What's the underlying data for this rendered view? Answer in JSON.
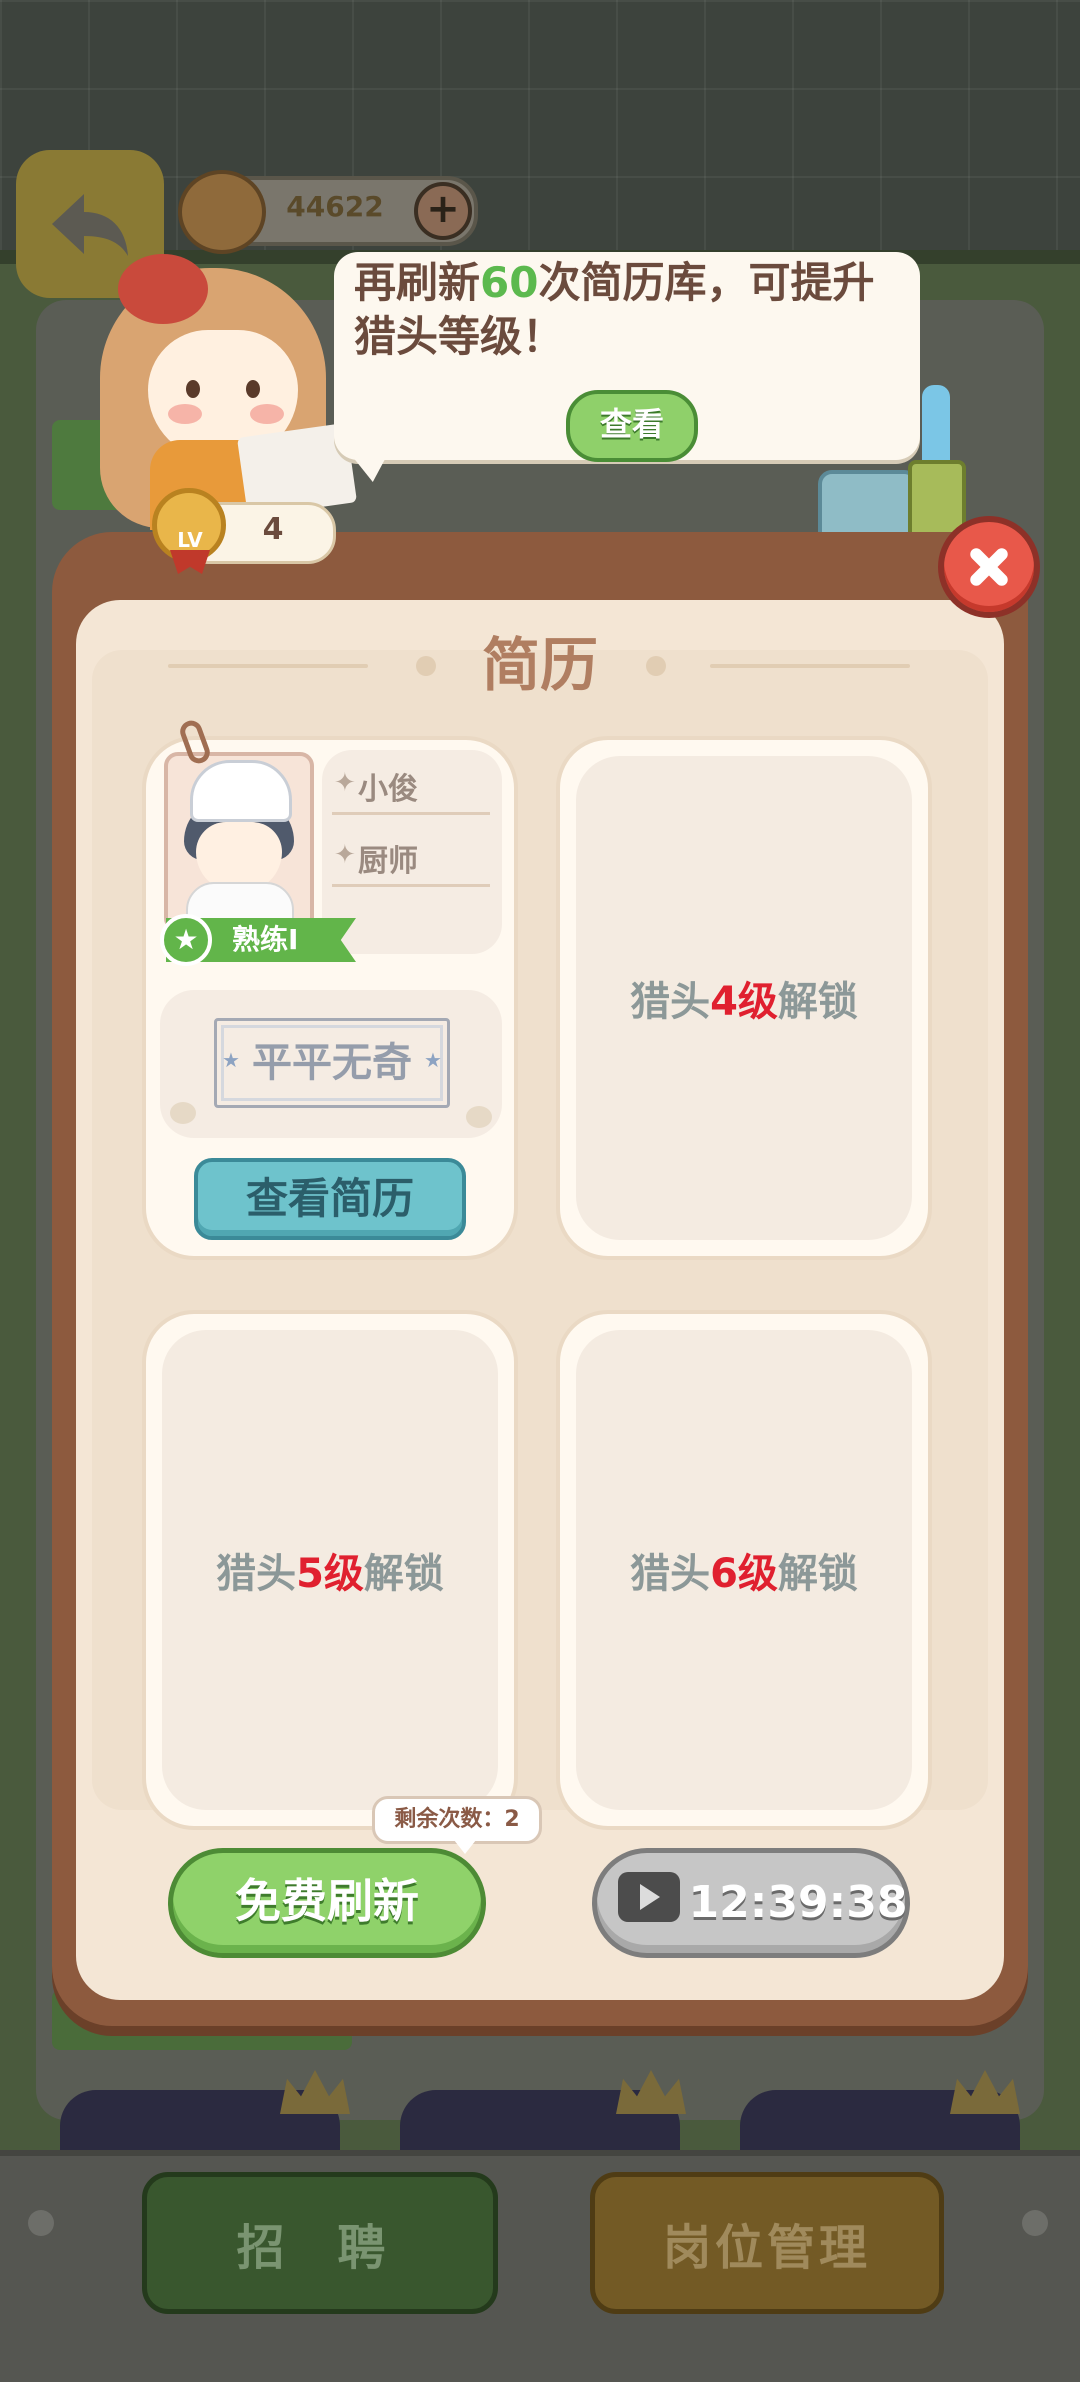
{
  "currency": {
    "value": "44622",
    "plus_label": "+"
  },
  "tip": {
    "line_before": "再刷新",
    "highlight": "60",
    "line_after": "次简历库，可提升猎头等级！",
    "view_label": "查看"
  },
  "level": {
    "badge": "LV",
    "value": "4"
  },
  "panel": {
    "title": "简历"
  },
  "resume": {
    "name": "小俊",
    "job": "厨师",
    "skill": "熟练I",
    "rating": "平平无奇",
    "view_button": "查看简历"
  },
  "locked_slots": [
    {
      "prefix": "猎头",
      "level": "4级",
      "suffix": "解锁"
    },
    {
      "prefix": "猎头",
      "level": "5级",
      "suffix": "解锁"
    },
    {
      "prefix": "猎头",
      "level": "6级",
      "suffix": "解锁"
    }
  ],
  "refresh": {
    "remaining": "剩余次数：2",
    "free_label": "免费刷新",
    "timer": "12:39:38"
  },
  "bottom_nav": {
    "recruit": "招 聘",
    "positions": "岗位管理"
  },
  "colors": {
    "accent_green": "#5cb94e",
    "lock_red": "#e0202f",
    "panel_brown": "#8d5a3e"
  }
}
